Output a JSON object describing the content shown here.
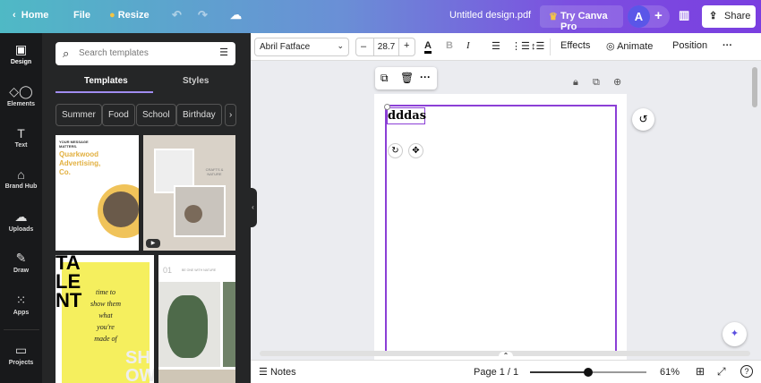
{
  "topbar": {
    "home": "Home",
    "file": "File",
    "resize": "Resize",
    "title": "Untitled design.pdf",
    "try_pro": "Try Canva Pro",
    "avatar": "A",
    "share": "Share"
  },
  "rail": [
    {
      "label": "Design",
      "icon": "layout-icon"
    },
    {
      "label": "Elements",
      "icon": "shapes-icon"
    },
    {
      "label": "Text",
      "icon": "text-icon"
    },
    {
      "label": "Brand Hub",
      "icon": "brand-icon"
    },
    {
      "label": "Uploads",
      "icon": "upload-icon"
    },
    {
      "label": "Draw",
      "icon": "pen-icon"
    },
    {
      "label": "Apps",
      "icon": "apps-icon"
    },
    {
      "label": "Projects",
      "icon": "folder-icon"
    }
  ],
  "panel": {
    "search_placeholder": "Search templates",
    "tabs": [
      "Templates",
      "Styles"
    ],
    "chips": [
      "Summer",
      "Food",
      "School",
      "Birthday"
    ],
    "t1": {
      "kicker": "YOUR MESSAGE MATTERS.",
      "title": "Quarkwood Advertising, Co."
    },
    "t2": {
      "brand": "CRAFTS & NATURE"
    },
    "t3": {
      "big": "TA LE NT",
      "script": "time to show them what you're made of",
      "show": "SH OW"
    },
    "t4": {
      "num": "01",
      "caption": "BE ONE WITH NATURE"
    }
  },
  "toolbar": {
    "font": "Abril Fatface",
    "size": "28.7",
    "effects": "Effects",
    "animate": "Animate",
    "position": "Position"
  },
  "canvas": {
    "text": "dddas"
  },
  "bottom": {
    "notes": "Notes",
    "page": "Page 1 / 1",
    "zoom": "61%",
    "zoom_fraction": 0.5
  }
}
